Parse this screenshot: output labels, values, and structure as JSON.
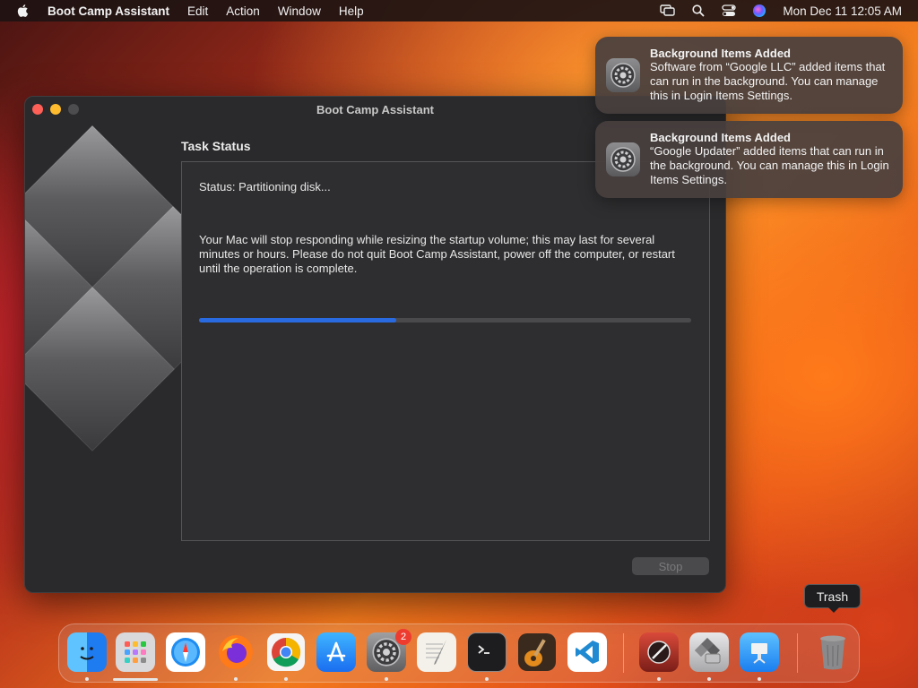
{
  "menubar": {
    "app_name": "Boot Camp Assistant",
    "items": [
      "Edit",
      "Action",
      "Window",
      "Help"
    ],
    "clock": "Mon Dec 11  12:05 AM",
    "status_icons": [
      "screen-mirroring-icon",
      "spotlight-icon",
      "control-center-icon",
      "siri-icon"
    ]
  },
  "window": {
    "title": "Boot Camp Assistant",
    "section_title": "Task Status",
    "status_text": "Status: Partitioning disk...",
    "warning_text": "Your Mac will stop responding while resizing the startup volume; this may last for several minutes or hours. Please do not quit Boot Camp Assistant, power off the computer, or restart until the operation is complete.",
    "progress_percent": 40,
    "stop_label": "Stop"
  },
  "notifications": [
    {
      "title": "Background Items Added",
      "body": "Software from “Google LLC” added items that can run in the background. You can manage this in Login Items Settings."
    },
    {
      "title": "Background Items Added",
      "body": "“Google Updater” added items that can run in the background. You can manage this in Login Items Settings."
    }
  ],
  "dock": {
    "tooltip": "Trash",
    "settings_badge": "2",
    "apps": [
      "finder-icon",
      "launchpad-icon",
      "safari-icon",
      "firefox-icon",
      "chrome-icon",
      "app-store-icon",
      "system-settings-icon",
      "textedit-icon",
      "terminal-icon",
      "garageband-icon",
      "vscode-icon",
      "instruments-icon",
      "boot-camp-icon",
      "keynote-icon",
      "trash-icon"
    ]
  },
  "colors": {
    "accent": "#2a6ae0",
    "close": "#fe5f57",
    "minimize": "#febc2e"
  }
}
